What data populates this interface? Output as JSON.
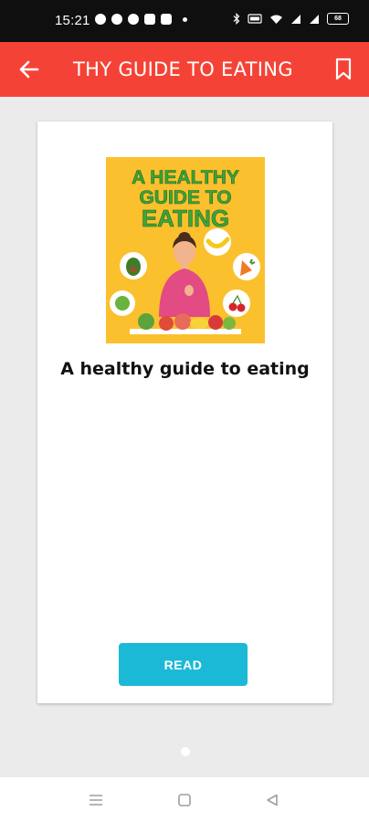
{
  "status_bar": {
    "time": "15:21",
    "battery": "68"
  },
  "toolbar": {
    "title": "THY GUIDE TO EATING",
    "back_icon": "arrow-left-icon",
    "bookmark_icon": "bookmark-icon",
    "color": "#f44336"
  },
  "book": {
    "cover_title_lines": [
      "A HEALTHY",
      "GUIDE TO",
      "EATING"
    ],
    "title": "A healthy guide to eating"
  },
  "actions": {
    "read_label": "READ",
    "read_color": "#1cb9d6"
  },
  "pager": {
    "current": 1,
    "total": 1
  },
  "nav_bar": {
    "icons": [
      "menu-icon",
      "home-icon",
      "back-triangle-icon"
    ]
  }
}
